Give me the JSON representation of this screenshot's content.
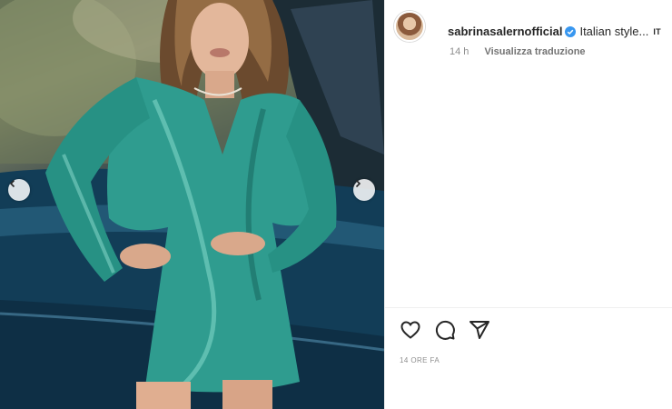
{
  "post": {
    "username": "sabrinasalernofficial",
    "caption": "Italian style...",
    "language_badge": "IT",
    "time_short": "14 h",
    "translate_label": "Visualizza traduzione",
    "time_long": "14 ORE FA",
    "verified": true
  },
  "media": {
    "dress_color": "#2f9c8f",
    "car_color": "#123d57"
  },
  "icons": {
    "prev": "chevron-left-icon",
    "next": "chevron-right-icon",
    "like": "heart-icon",
    "comment": "comment-icon",
    "share": "paper-plane-icon",
    "verified": "verified-badge-icon"
  }
}
